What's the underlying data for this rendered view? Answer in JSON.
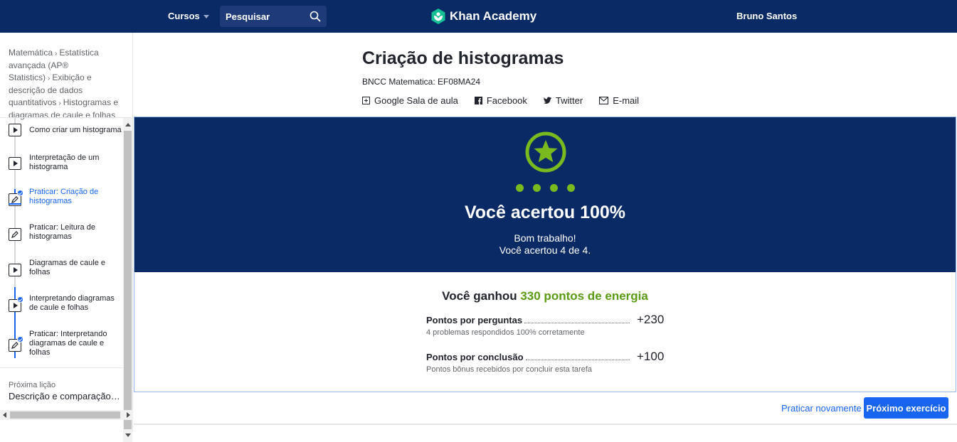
{
  "nav": {
    "courses": "Cursos",
    "search_placeholder": "Pesquisar",
    "brand": "Khan Academy",
    "user": "Bruno Santos"
  },
  "sidebar": {
    "breadcrumb": [
      "Matemática",
      "Estatística avançada (AP® Statistics)",
      "Exibição e descrição de dados quantitativos",
      "Histogramas e diagramas de caule e folhas"
    ],
    "lessons": [
      {
        "label": "Como criar um histograma",
        "type": "video",
        "completed": false,
        "active": false
      },
      {
        "label": "Interpretação de um histograma",
        "type": "video",
        "completed": false,
        "active": false
      },
      {
        "label": "Praticar: Criação de histogramas",
        "type": "exercise",
        "completed": true,
        "active": true
      },
      {
        "label": "Praticar: Leitura de histogramas",
        "type": "exercise",
        "completed": false,
        "active": false
      },
      {
        "label": "Diagramas de caule e folhas",
        "type": "video",
        "completed": false,
        "active": false
      },
      {
        "label": "Interpretando diagramas de caule e folhas",
        "type": "video",
        "completed": true,
        "active": false
      },
      {
        "label": "Praticar: Interpretando diagramas de caule e folhas",
        "type": "exercise",
        "completed": true,
        "active": false
      }
    ],
    "next_label": "Próxima lição",
    "next_title": "Descrição e comparação de distribuições"
  },
  "header": {
    "title": "Criação de histogramas",
    "bncc": "BNCC Matematica: EF08MA24",
    "share": {
      "classroom": "Google Sala de aula",
      "facebook": "Facebook",
      "twitter": "Twitter",
      "email": "E-mail"
    }
  },
  "result": {
    "title": "Você acertou 100%",
    "line1": "Bom trabalho!",
    "line2": "Você acertou 4 de 4.",
    "correct": 4,
    "total": 4,
    "energy_prefix": "Você ganhou ",
    "energy_points": "330 pontos de energia",
    "rows": [
      {
        "name": "Pontos por perguntas",
        "value": "+230",
        "desc": "4 problemas respondidos 100% corretamente"
      },
      {
        "name": "Pontos por conclusão",
        "value": "+100",
        "desc": "Pontos bônus recebidos por concluir esta tarefa"
      }
    ]
  },
  "actions": {
    "practice_again": "Praticar novamente",
    "next_exercise": "Próximo exercício"
  },
  "colors": {
    "navy": "#0a2a66",
    "green": "#7aba1e",
    "blue": "#1865f2"
  }
}
